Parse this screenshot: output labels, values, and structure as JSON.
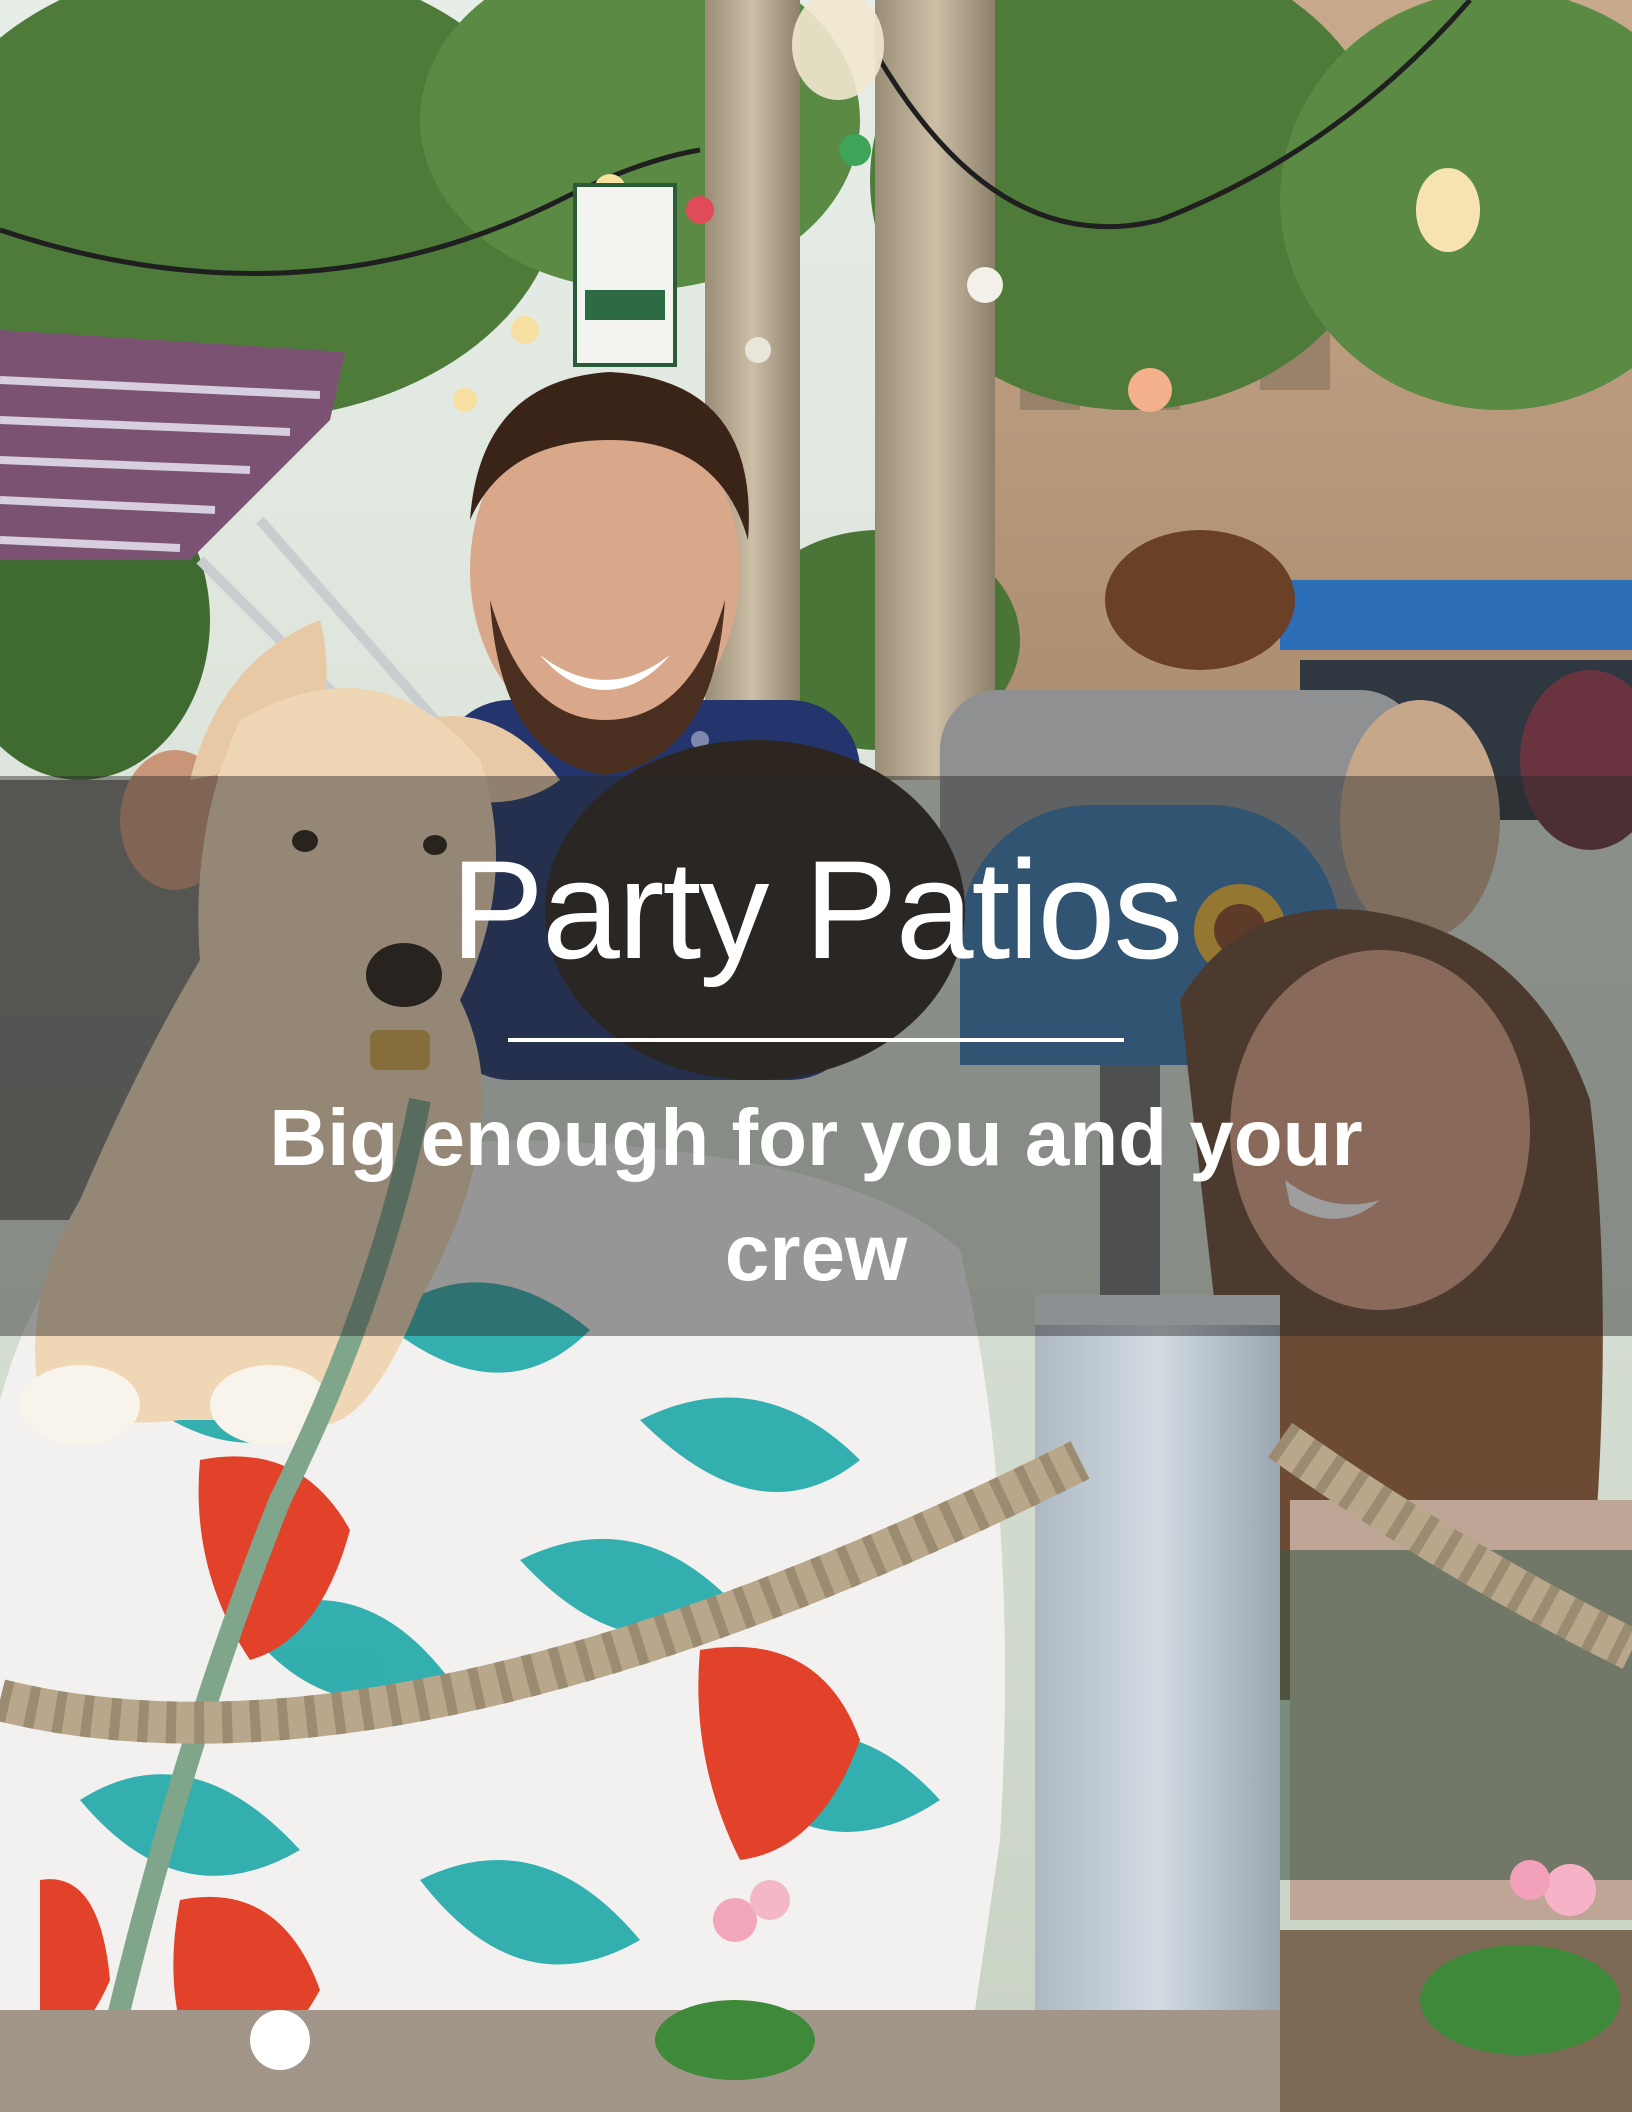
{
  "hero": {
    "headline": "Party Patios",
    "subline": "Big enough for you and your crew"
  },
  "colors": {
    "headline_text": "#ffffff",
    "overlay": "#282828",
    "shirt_teal": "#1fa7a7",
    "shirt_red": "#e2412a",
    "mailbox_blue": "#3a79b0"
  }
}
